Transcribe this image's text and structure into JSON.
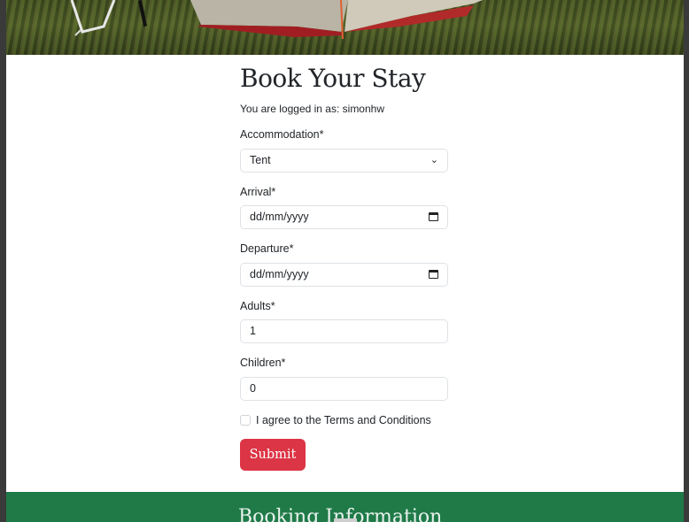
{
  "page": {
    "title": "Book Your Stay",
    "logged_in_text": "You are logged in as: simonhw"
  },
  "form": {
    "accommodation": {
      "label": "Accommodation*",
      "value": "Tent",
      "icon": "chevron-down-icon"
    },
    "arrival": {
      "label": "Arrival*",
      "value": "dd/mm/yyyy",
      "icon": "calendar-icon"
    },
    "departure": {
      "label": "Departure*",
      "value": "dd/mm/yyyy",
      "icon": "calendar-icon"
    },
    "adults": {
      "label": "Adults*",
      "value": "1"
    },
    "children": {
      "label": "Children*",
      "value": "0"
    },
    "terms": {
      "label": "I agree to the Terms and Conditions",
      "checked": false
    },
    "submit_label": "Submit"
  },
  "footer": {
    "heading": "Booking Information"
  },
  "colors": {
    "submit": "#dc3545",
    "footer": "#1f7a48"
  }
}
